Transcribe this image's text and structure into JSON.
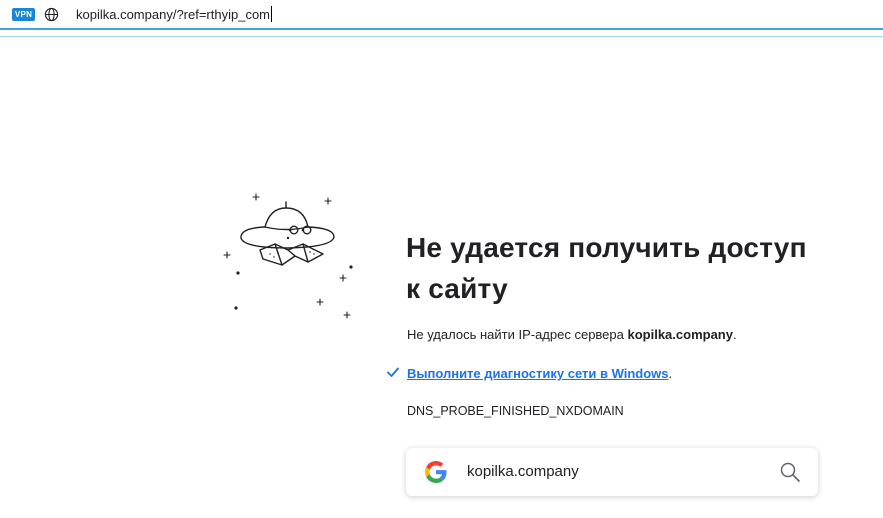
{
  "address_bar": {
    "vpn_label": "VPN",
    "url": "kopilka.company/?ref=rthyip_com"
  },
  "error": {
    "title": "Не удается получить доступ к сайту",
    "desc_prefix": "Не удалось найти IP-адрес сервера ",
    "desc_host": "kopilka.company",
    "desc_suffix": ".",
    "diagnostics_link": "Выполните диагностику сети в Windows",
    "diagnostics_suffix": ".",
    "code": "DNS_PROBE_FINISHED_NXDOMAIN"
  },
  "search": {
    "query": "kopilka.company"
  },
  "colors": {
    "accent": "#1a73e8",
    "address_border": "#3ea6e6",
    "vpn_badge": "#1a86d8"
  },
  "icons": [
    "vpn-badge",
    "globe-icon",
    "ufo-illustration",
    "check-icon",
    "google-g-icon",
    "search-icon"
  ]
}
